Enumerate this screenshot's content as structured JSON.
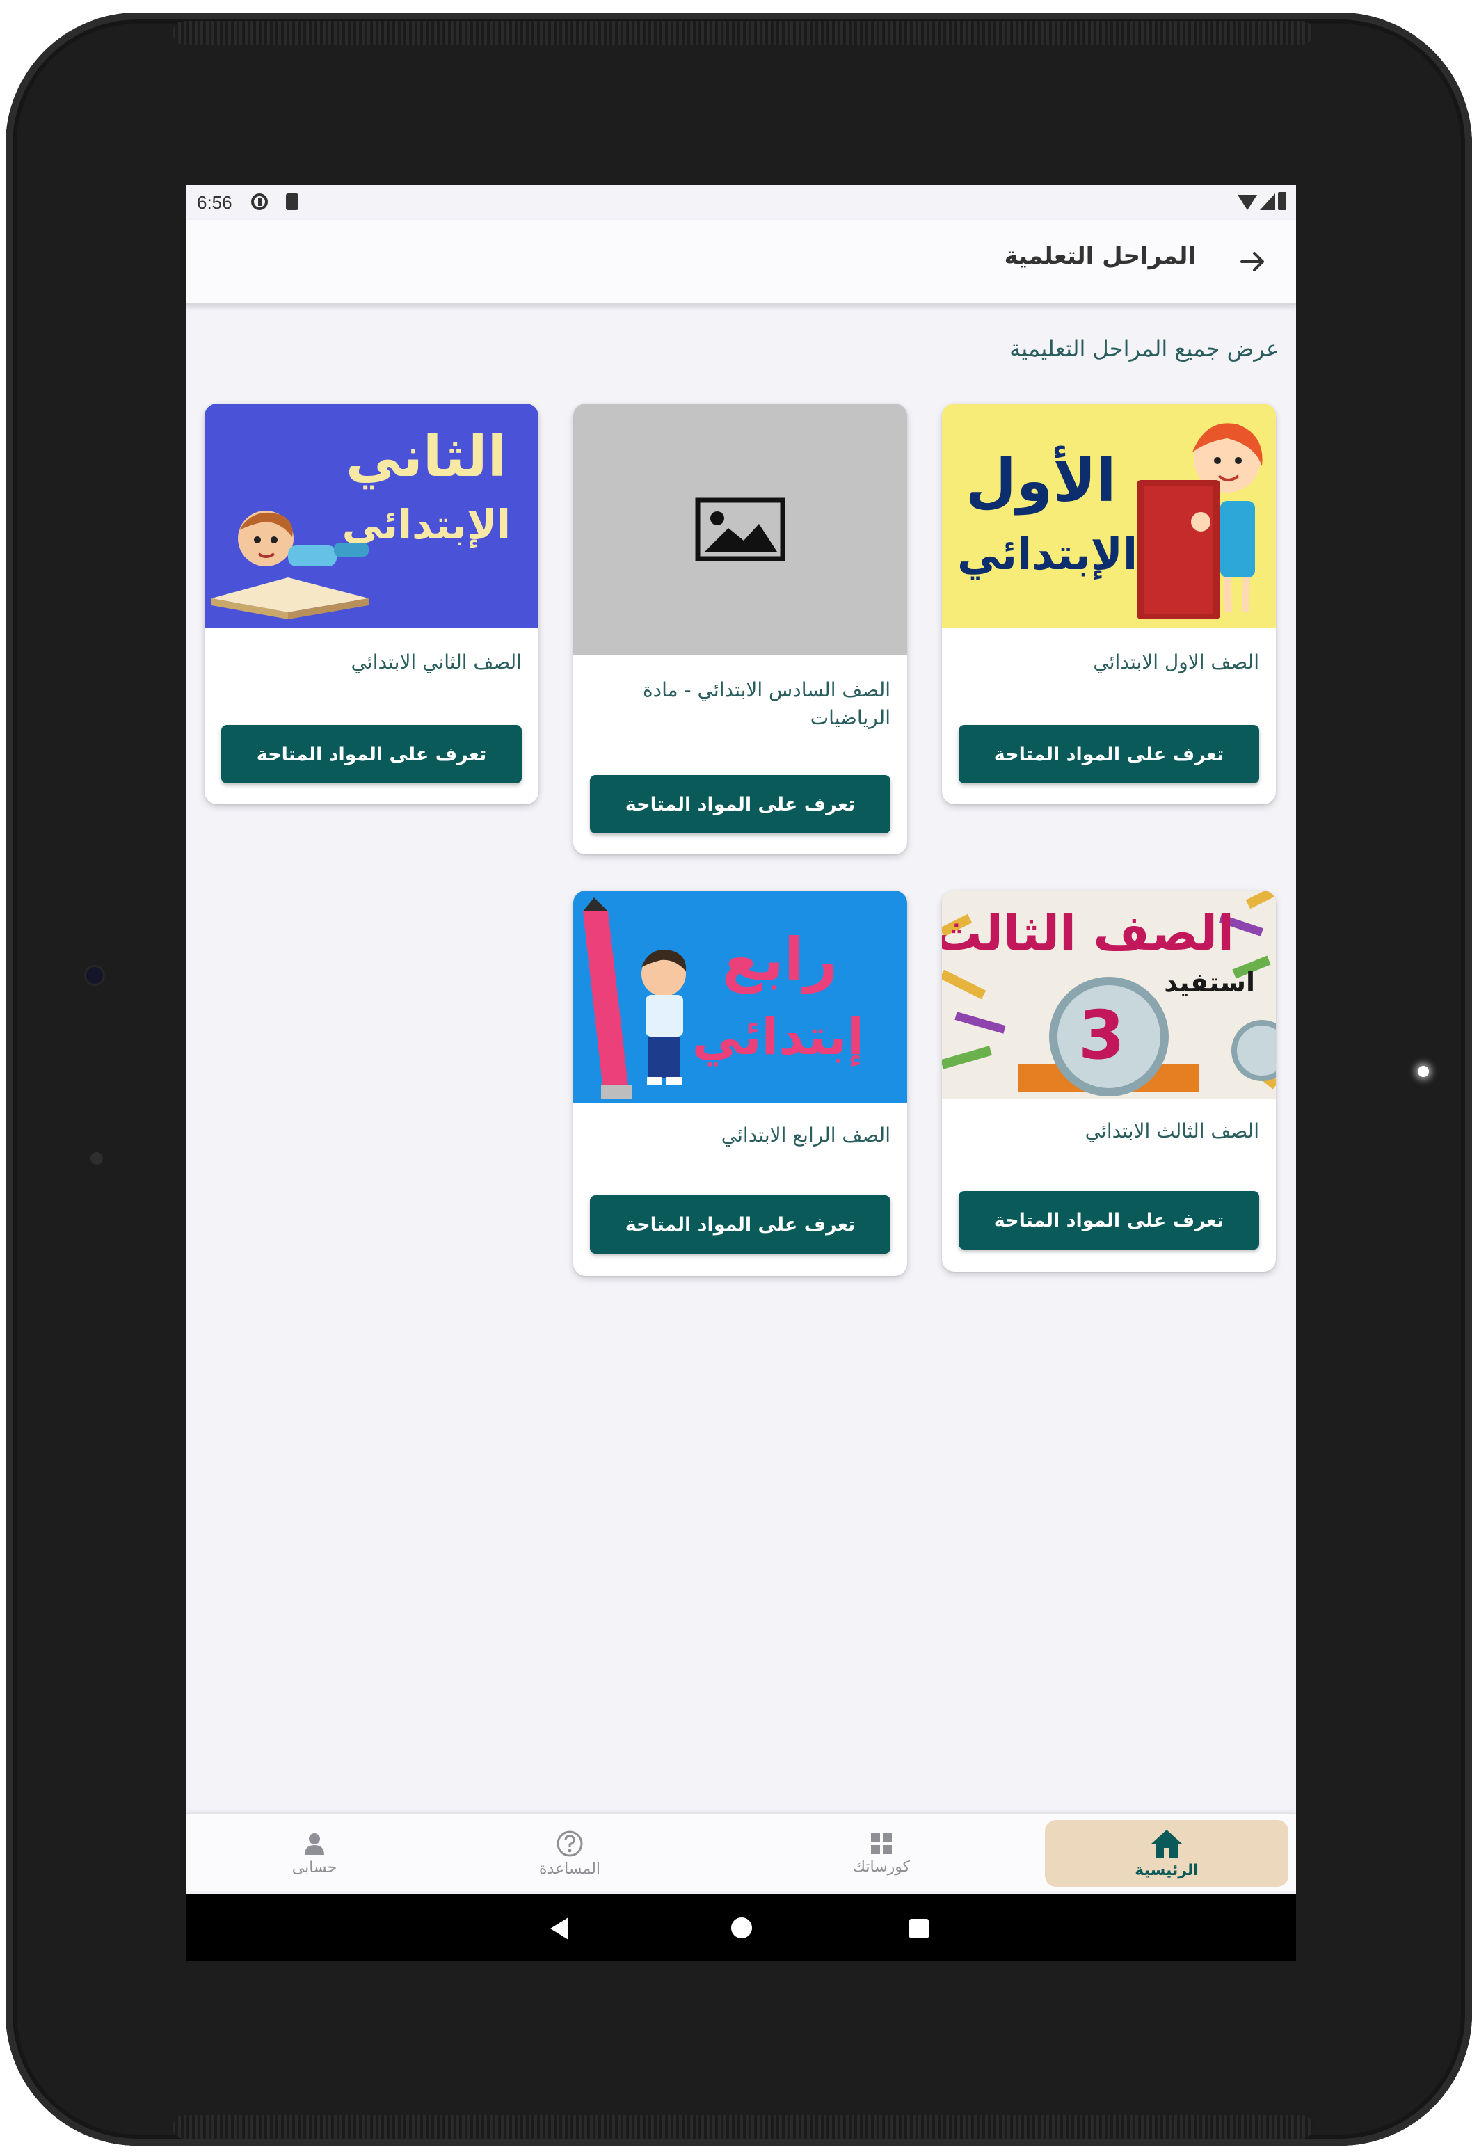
{
  "status_bar": {
    "time": "6:56"
  },
  "app_bar": {
    "title": "المراحل التعلمية"
  },
  "subtitle": "عرض جميع المراحل التعليمية",
  "cards": [
    {
      "name": "الصف الاول الابتدائي",
      "button": "تعرف على المواد المتاحة",
      "image_text_1": "الأول",
      "image_text_2": "الإبتدائي"
    },
    {
      "name": "الصف السادس الابتدائي - مادة الرياضيات",
      "button": "تعرف على المواد المتاحة"
    },
    {
      "name": "الصف الثاني الابتدائي",
      "button": "تعرف على المواد المتاحة",
      "image_text_1": "الثاني",
      "image_text_2": "الإبتدائي"
    },
    {
      "name": "الصف الثالث الابتدائي",
      "button": "تعرف على المواد المتاحة",
      "image_text_1": "الصف الثالث",
      "image_text_2": "استفيد",
      "image_text_3": "3"
    },
    {
      "name": "الصف الرابع الابتدائي",
      "button": "تعرف على المواد المتاحة",
      "image_text_1": "رابع",
      "image_text_2": "إبتدائي"
    }
  ],
  "bottom_nav": [
    {
      "label": "الرئيسية",
      "icon": "home-icon",
      "active": true
    },
    {
      "label": "كورساتك",
      "icon": "grid-icon"
    },
    {
      "label": "المساعدة",
      "icon": "help-icon"
    },
    {
      "label": "حسابى",
      "icon": "person-icon"
    }
  ],
  "colors": {
    "primary": "#0b5a5a",
    "nav_active_bg": "#ecd8bd",
    "background": "#f4f3f8"
  }
}
